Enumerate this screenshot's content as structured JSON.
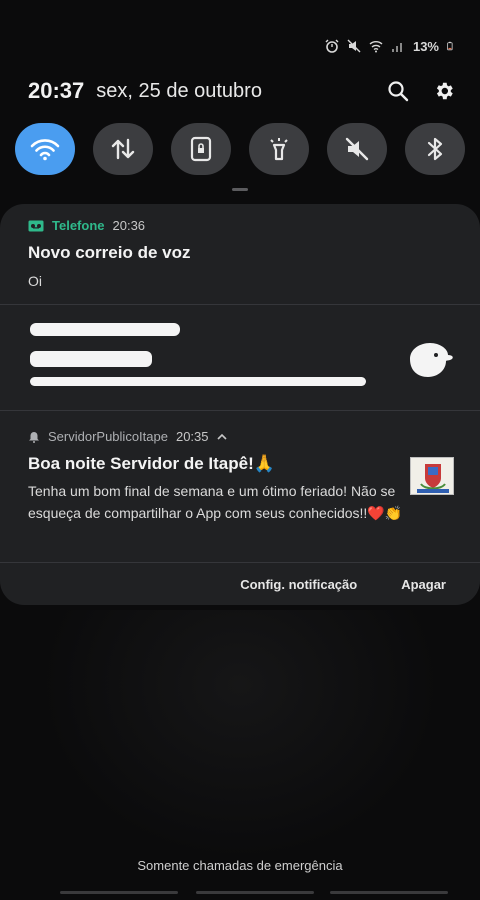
{
  "status_bar": {
    "battery": "13%",
    "icons": [
      "alarm-icon",
      "mute-icon",
      "wifi-icon",
      "signal-icon",
      "battery-icon"
    ]
  },
  "header": {
    "time": "20:37",
    "date": "sex, 25 de outubro",
    "actions": [
      "search-icon",
      "gear-icon"
    ]
  },
  "quick_toggles": [
    {
      "name": "wifi",
      "on": true
    },
    {
      "name": "mobile-data",
      "on": false
    },
    {
      "name": "screen-lock",
      "on": false
    },
    {
      "name": "flashlight",
      "on": false
    },
    {
      "name": "sound-mute",
      "on": false
    },
    {
      "name": "bluetooth",
      "on": false
    }
  ],
  "notifications": {
    "voicemail": {
      "app": "Telefone",
      "time": "20:36",
      "title": "Novo correio de voz",
      "body": "Oi"
    },
    "app": {
      "app": "ServidorPublicoItape",
      "time": "20:35",
      "title": "Boa noite Servidor de Itapê!🙏",
      "body": "Tenha um bom final de semana e um ótimo feriado! Não se esqueça de compartilhar o App com seus conhecidos!!❤️👏"
    }
  },
  "notification_actions": {
    "settings": "Config. notificação",
    "clear": "Apagar"
  },
  "footer": {
    "emergency": "Somente chamadas de emergência"
  },
  "colors": {
    "accent": "#4a9df0",
    "telefone_green": "#2fb98b",
    "panel": "#202123",
    "toggle_off": "#3c3d40"
  }
}
